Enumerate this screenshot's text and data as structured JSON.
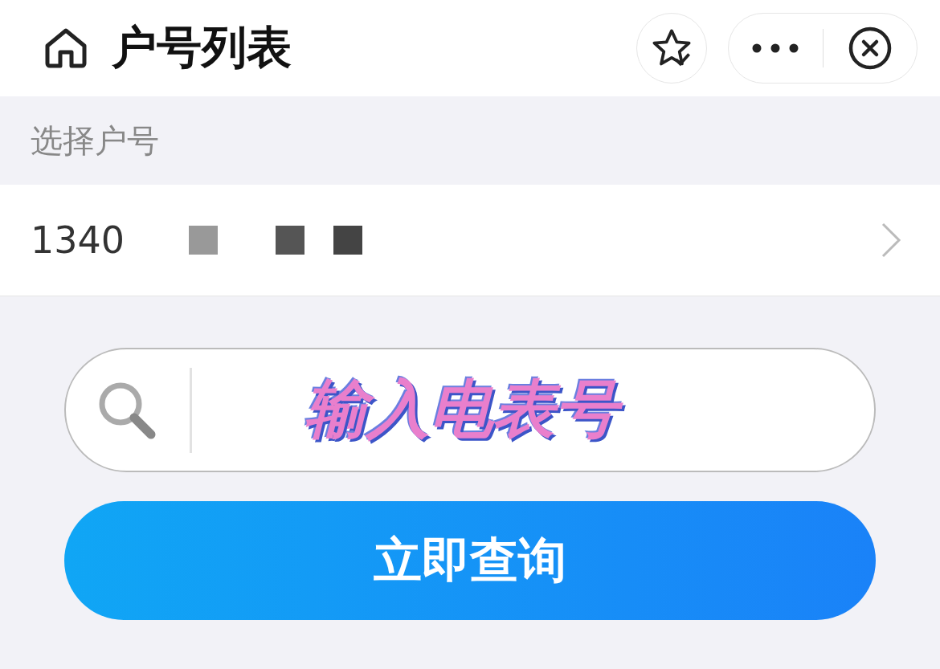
{
  "header": {
    "title": "户号列表"
  },
  "section_label": "选择户号",
  "accounts": [
    {
      "number": "1340"
    }
  ],
  "search": {
    "annotation": "输入电表号"
  },
  "query_button": "立即查询"
}
